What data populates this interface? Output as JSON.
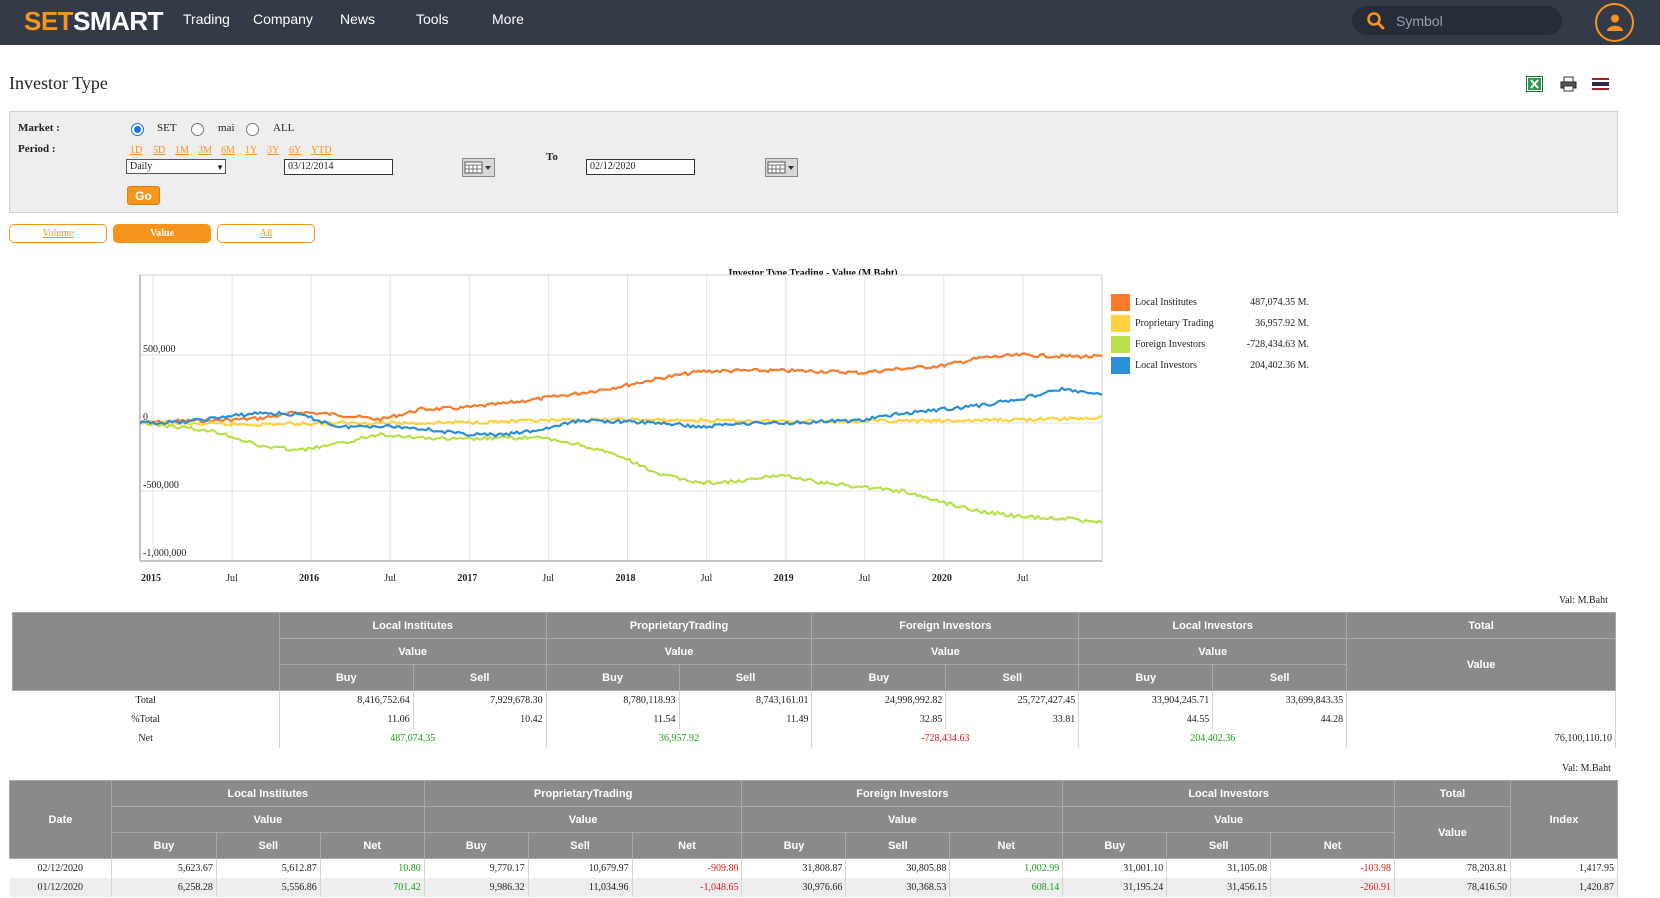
{
  "nav": {
    "logo_a": "SET",
    "logo_b": "SMART",
    "items": [
      "Trading",
      "Company",
      "News",
      "Tools",
      "More"
    ],
    "search_placeholder": "Symbol"
  },
  "page_title": "Investor Type",
  "filter": {
    "market_label": "Market :",
    "markets": [
      "SET",
      "mai",
      "ALL"
    ],
    "market_selected": "SET",
    "period_label": "Period :",
    "period_links": [
      "1D",
      "5D",
      "1M",
      "3M",
      "6M",
      "1Y",
      "3Y",
      "6Y",
      "YTD"
    ],
    "frequency": "Daily",
    "from_date": "03/12/2014",
    "to_label": "To",
    "to_date": "02/12/2020",
    "go_label": "Go"
  },
  "tabs": {
    "volume": "Volume",
    "value": "Value",
    "all": "All",
    "active": "Value"
  },
  "chart_data": {
    "type": "line",
    "title": "Investor Type Trading - Value (M.Baht)",
    "ylim": [
      -1000000,
      1000000
    ],
    "y_ticks": [
      "500,000",
      "0",
      "-500,000",
      "-1,000,000"
    ],
    "x_ticks": [
      "2015",
      "Jul",
      "2016",
      "Jul",
      "2017",
      "Jul",
      "2018",
      "Jul",
      "2019",
      "Jul",
      "2020",
      "Jul"
    ],
    "x_dates": [
      "2015-01",
      "2015-07",
      "2016-01",
      "2016-07",
      "2017-01",
      "2017-07",
      "2018-01",
      "2018-07",
      "2019-01",
      "2019-07",
      "2020-01",
      "2020-07",
      "2020-12"
    ],
    "grid": true,
    "legend_position": "right",
    "series": [
      {
        "name": "Local Institutes",
        "color": "#f97a2a",
        "value_label": "487,074.35 M.",
        "values": [
          0,
          15000,
          20000,
          35000,
          80000,
          60000,
          25000,
          100000,
          110000,
          140000,
          180000,
          220000,
          270000,
          330000,
          380000,
          385000,
          385000,
          380000,
          370000,
          400000,
          420000,
          480000,
          500000,
          490000,
          487074
        ]
      },
      {
        "name": "Proprietary Trading",
        "color": "#fcd33e",
        "value_label": "36,957.92 M.",
        "values": [
          0,
          -5000,
          -10000,
          -10000,
          -5000,
          0,
          0,
          0,
          5000,
          10000,
          15000,
          20000,
          25000,
          20000,
          20000,
          15000,
          15000,
          15000,
          15000,
          15000,
          15000,
          20000,
          25000,
          30000,
          36958
        ]
      },
      {
        "name": "Foreign Investors",
        "color": "#b8e04a",
        "value_label": "-728,434.63 M.",
        "values": [
          0,
          -30000,
          -70000,
          -170000,
          -200000,
          -150000,
          -80000,
          -110000,
          -120000,
          -110000,
          -110000,
          -160000,
          -250000,
          -380000,
          -440000,
          -430000,
          -380000,
          -440000,
          -470000,
          -500000,
          -580000,
          -650000,
          -690000,
          -700000,
          -728435
        ]
      },
      {
        "name": "Local Investors",
        "color": "#2b8fd6",
        "value_label": "204,402.36 M.",
        "values": [
          0,
          5000,
          40000,
          75000,
          60000,
          -30000,
          -20000,
          -40000,
          -80000,
          -90000,
          -50000,
          20000,
          10000,
          0,
          -30000,
          0,
          0,
          10000,
          20000,
          70000,
          100000,
          130000,
          180000,
          250000,
          204402
        ]
      }
    ]
  },
  "summary": {
    "unit": "Val: M.Baht",
    "groups": [
      "Local Institutes",
      "ProprietaryTrading",
      "Foreign Investors",
      "Local Investors",
      "Total"
    ],
    "sub": "Value",
    "buy": "Buy",
    "sell": "Sell",
    "rows": [
      {
        "label": "Total",
        "vals": [
          "8,416,752.64",
          "7,929,678.30",
          "8,780,118.93",
          "8,743,161.01",
          "24,998,992.82",
          "25,727,427.45",
          "33,904,245.71",
          "33,699,843.35"
        ],
        "total": ""
      },
      {
        "label": "%Total",
        "vals": [
          "11.06",
          "10.42",
          "11.54",
          "11.49",
          "32.85",
          "33.81",
          "44.55",
          "44.28"
        ],
        "total": ""
      }
    ],
    "net_label": "Net",
    "net": [
      "487,074.35",
      "36,957.92",
      "-728,434.63",
      "204,402.36"
    ],
    "net_total": "76,100,110.10"
  },
  "daily": {
    "unit": "Val: M.Baht",
    "date_header": "Date",
    "groups": [
      "Local Institutes",
      "ProprietaryTrading",
      "Foreign Investors",
      "Local Investors",
      "Total"
    ],
    "index_header": "Index",
    "sub": "Value",
    "cols": [
      "Buy",
      "Sell",
      "Net"
    ],
    "rows": [
      {
        "date": "02/12/2020",
        "vals": [
          "5,623.67",
          "5,612.87",
          "10.80",
          "9,770.17",
          "10,679.97",
          "-909.80",
          "31,808.87",
          "30,805.88",
          "1,002.99",
          "31,001.10",
          "31,105.08",
          "-103.98"
        ],
        "total": "78,203.81",
        "index": "1,417.95"
      },
      {
        "date": "01/12/2020",
        "vals": [
          "6,258.28",
          "5,556.86",
          "701.42",
          "9,986.32",
          "11,034.96",
          "-1,048.65",
          "30,976.66",
          "30,368.53",
          "608.14",
          "31,195.24",
          "31,456.15",
          "-260.91"
        ],
        "total": "78,416.50",
        "index": "1,420.87"
      }
    ]
  }
}
